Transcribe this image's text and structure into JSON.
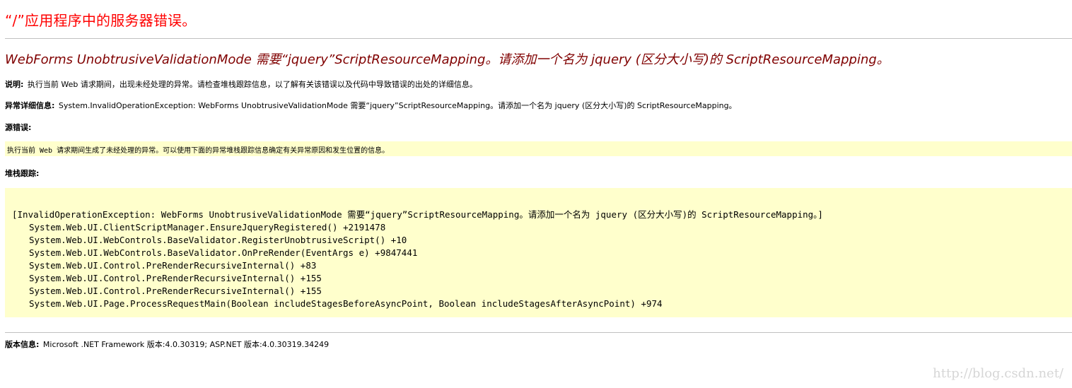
{
  "app_title": "“/”应用程序中的服务器错误。",
  "error_heading": "WebForms UnobtrusiveValidationMode 需要“jquery”ScriptResourceMapping。请添加一个名为 jquery (区分大小写)的 ScriptResourceMapping。",
  "description": {
    "label": "说明:",
    "text": "执行当前 Web 请求期间，出现未经处理的异常。请检查堆栈跟踪信息，以了解有关该错误以及代码中导致错误的出处的详细信息。"
  },
  "exception_details": {
    "label": "异常详细信息:",
    "text": "System.InvalidOperationException: WebForms UnobtrusiveValidationMode 需要“jquery”ScriptResourceMapping。请添加一个名为 jquery (区分大小写)的 ScriptResourceMapping。"
  },
  "source_error": {
    "label": "源错误:",
    "text": "执行当前 Web 请求期间生成了未经处理的异常。可以使用下面的异常堆栈跟踪信息确定有关异常原因和发生位置的信息。"
  },
  "stack_trace": {
    "label": "堆栈跟踪:",
    "exception_line": "[InvalidOperationException: WebForms UnobtrusiveValidationMode 需要“jquery”ScriptResourceMapping。请添加一个名为 jquery (区分大小写)的 ScriptResourceMapping。]",
    "frames": [
      "System.Web.UI.ClientScriptManager.EnsureJqueryRegistered() +2191478",
      "System.Web.UI.WebControls.BaseValidator.RegisterUnobtrusiveScript() +10",
      "System.Web.UI.WebControls.BaseValidator.OnPreRender(EventArgs e) +9847441",
      "System.Web.UI.Control.PreRenderRecursiveInternal() +83",
      "System.Web.UI.Control.PreRenderRecursiveInternal() +155",
      "System.Web.UI.Control.PreRenderRecursiveInternal() +155",
      "System.Web.UI.Page.ProcessRequestMain(Boolean includeStagesBeforeAsyncPoint, Boolean includeStagesAfterAsyncPoint) +974"
    ]
  },
  "version_info": {
    "label": "版本信息:",
    "text": "Microsoft .NET Framework 版本:4.0.30319; ASP.NET 版本:4.0.30319.34249"
  },
  "watermark": "http://blog.csdn.net/",
  "colors": {
    "title": "#ff0000",
    "heading": "#800000",
    "highlight_background": "#ffffcc",
    "rule": "#c0c0c0",
    "watermark": "#d6d6d6"
  }
}
